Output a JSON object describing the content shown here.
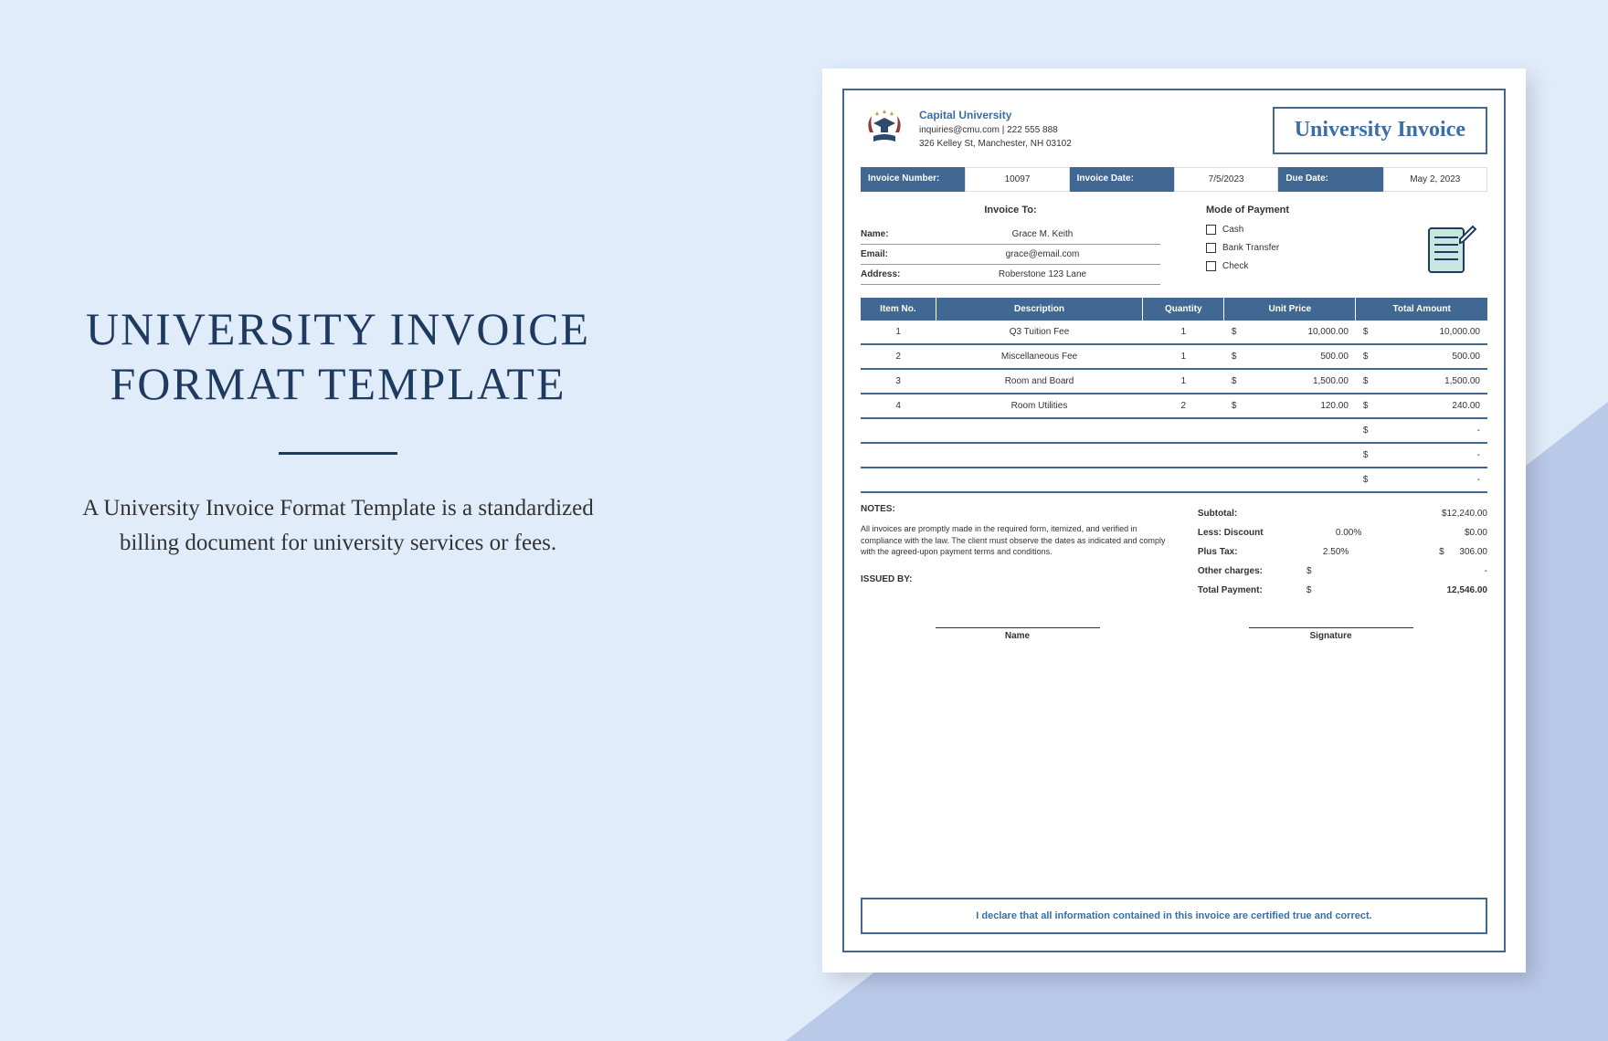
{
  "left": {
    "title_line1": "UNIVERSITY INVOICE",
    "title_line2": "FORMAT TEMPLATE",
    "description": "A University Invoice Format Template is a standardized billing document for university services or fees."
  },
  "invoice": {
    "university_name": "Capital University",
    "contact": "inquiries@cmu.com | 222 555 888",
    "address": "326 Kelley St, Manchester, NH 03102",
    "title": "University Invoice",
    "meta": {
      "invoice_number_label": "Invoice Number:",
      "invoice_number": "10097",
      "invoice_date_label": "Invoice Date:",
      "invoice_date": "7/5/2023",
      "due_date_label": "Due Date:",
      "due_date": "May 2, 2023"
    },
    "invoice_to": {
      "title": "Invoice To:",
      "name_label": "Name:",
      "name": "Grace M. Keith",
      "email_label": "Email:",
      "email": "grace@email.com",
      "address_label": "Address:",
      "address": "Roberstone 123 Lane"
    },
    "payment": {
      "title": "Mode of Payment",
      "options": [
        "Cash",
        "Bank Transfer",
        "Check"
      ]
    },
    "columns": {
      "item_no": "Item No.",
      "description": "Description",
      "quantity": "Quantity",
      "unit_price": "Unit Price",
      "total": "Total Amount"
    },
    "items": [
      {
        "no": "1",
        "desc": "Q3 Tuition Fee",
        "qty": "1",
        "price": "10,000.00",
        "total": "10,000.00"
      },
      {
        "no": "2",
        "desc": "Miscellaneous Fee",
        "qty": "1",
        "price": "500.00",
        "total": "500.00"
      },
      {
        "no": "3",
        "desc": "Room and Board",
        "qty": "1",
        "price": "1,500.00",
        "total": "1,500.00"
      },
      {
        "no": "4",
        "desc": "Room Utilities",
        "qty": "2",
        "price": "120.00",
        "total": "240.00"
      }
    ],
    "empty_mark": "-",
    "totals": {
      "subtotal_label": "Subtotal:",
      "subtotal": "$12,240.00",
      "discount_label": "Less: Discount",
      "discount_pct": "0.00%",
      "discount_val": "$0.00",
      "tax_label": "Plus Tax:",
      "tax_pct": "2.50%",
      "tax_cur": "$",
      "tax_val": "306.00",
      "other_label": "Other charges:",
      "other_cur": "$",
      "other_val": "-",
      "total_label": "Total Payment:",
      "total_cur": "$",
      "total_val": "12,546.00"
    },
    "notes": {
      "title": "NOTES:",
      "text": "All invoices are promptly made in the required form, itemized, and verified in compliance with the law. The client must observe the dates as indicated and comply with the agreed-upon payment terms and conditions.",
      "issued": "ISSUED BY:"
    },
    "signatures": {
      "name": "Name",
      "signature": "Signature"
    },
    "declaration": "I declare that all information contained in this invoice are certified true and correct."
  }
}
